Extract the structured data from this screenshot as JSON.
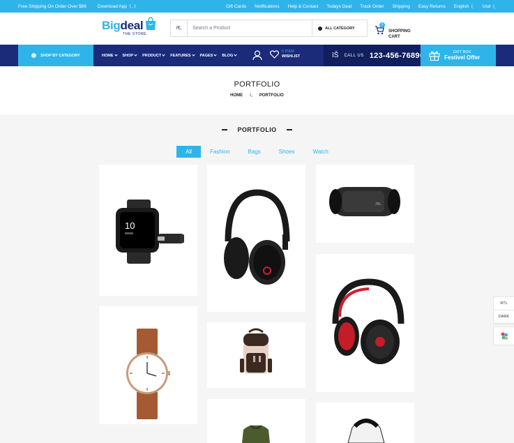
{
  "topbar": {
    "shipping": "Free Shipping On Order Over $99",
    "download": "Download App",
    "download_icons": "ï ,  ï",
    "links": [
      "Gift Cards",
      "Notifications",
      "Help & Contact",
      "Todays Deal",
      "Track Order",
      "Shipping",
      "Easy Returns"
    ],
    "language": "English",
    "currency": "Usd",
    "dropdown_glyph": "ï¸"
  },
  "header": {
    "logo_big": "Big",
    "logo_deal": "deal",
    "logo_sub": "THE STORE",
    "search_icon_glyph": "ï€‚",
    "search_placeholder": "Search a Product",
    "category_label": "ALL CATEGORY",
    "cart_count": "0",
    "cart_line1": "SHOPPING",
    "cart_line2": "CART"
  },
  "nav": {
    "shop_by_category": "SHOP BY CATEGORY",
    "menu": [
      "HOME",
      "SHOP",
      "PRODUCT",
      "FEATURES",
      "PAGES",
      "BLOG"
    ],
    "wishlist_count": "0 ITEM",
    "wishlist_label": "WISHLIST",
    "call_glyph": "ïŠ",
    "call_label": "CALL US",
    "call_number": "123-456-76890",
    "gift_small": "GIFT BOX",
    "gift_big": "Festivel Offer"
  },
  "banner": {
    "title": "PORTFOLIO",
    "crumb_home": "HOME",
    "crumb_sep": "ï„",
    "crumb_current": "PORTFOLIO"
  },
  "section": {
    "title": "PORTFOLIO",
    "filters": [
      "All",
      "Fashion",
      "Bags",
      "Shoes",
      "Watch"
    ],
    "active_filter": "All"
  },
  "products": [
    "smartwatch-icon",
    "headphones-icon",
    "speaker-icon",
    "headphones-red-icon",
    "analog-watch-icon",
    "backpack-icon",
    "jacket-icon",
    "hoodie-icon"
  ],
  "side_tools": {
    "rtl": "RTL",
    "dark": "DARK"
  },
  "colors": {
    "accent": "#2fb4ea",
    "navy": "#1b2b7a",
    "navy_dark": "#111f5e"
  }
}
